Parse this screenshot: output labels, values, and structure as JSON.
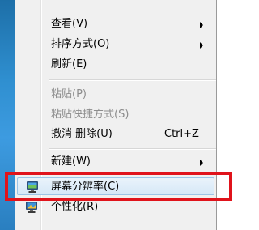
{
  "menu": {
    "items": [
      {
        "label": "查看(V)",
        "submenu": true
      },
      {
        "label": "排序方式(O)",
        "submenu": true
      },
      {
        "label": "刷新(E)"
      },
      {
        "label": "粘贴(P)",
        "disabled": true
      },
      {
        "label": "粘贴快捷方式(S)",
        "disabled": true
      },
      {
        "label": "撤消 删除(U)",
        "shortcut": "Ctrl+Z"
      },
      {
        "label": "新建(W)",
        "submenu": true
      },
      {
        "label": "屏幕分辨率(C)",
        "icon": "monitor-icon",
        "highlighted": true
      },
      {
        "label": "个性化(R)",
        "icon": "personalize-icon"
      }
    ]
  },
  "colors": {
    "highlight_border": "#e0131b",
    "hover_border": "#9cc4e6",
    "desktop": "#2f8fd0"
  }
}
